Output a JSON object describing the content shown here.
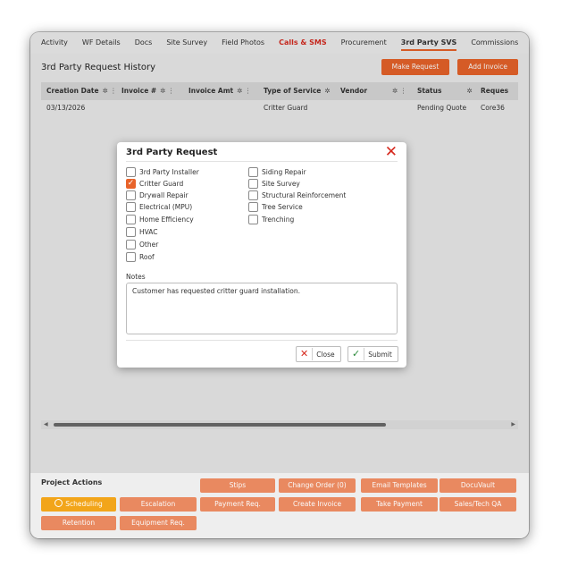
{
  "tabs": [
    "Activity",
    "WF Details",
    "Docs",
    "Site Survey",
    "Field Photos",
    "Calls & SMS",
    "Procurement",
    "3rd Party SVS",
    "Commissions"
  ],
  "tabs_highlight": "Calls & SMS",
  "tabs_active": "3rd Party SVS",
  "section_title": "3rd Party Request History",
  "buttons": {
    "make_request": "Make Request",
    "add_invoice": "Add Invoice"
  },
  "grid": {
    "columns": [
      "Creation Date",
      "Invoice #",
      "Invoice Amt",
      "Type of Service",
      "Vendor",
      "",
      "Status",
      "Reques"
    ],
    "rows": [
      {
        "creation_date": "03/13/2026",
        "invoice_no": "",
        "invoice_amt": "",
        "type_of_service": "Critter Guard",
        "vendor": "",
        "status": "Pending Quote",
        "request": "Core36"
      }
    ]
  },
  "dialog": {
    "title": "3rd Party Request",
    "close_icon": "close-x-icon",
    "options_left": [
      {
        "label": "3rd Party Installer",
        "checked": false
      },
      {
        "label": "Critter Guard",
        "checked": true
      },
      {
        "label": "Drywall Repair",
        "checked": false
      },
      {
        "label": "Electrical (MPU)",
        "checked": false
      },
      {
        "label": "Home Efficiency",
        "checked": false
      },
      {
        "label": "HVAC",
        "checked": false
      },
      {
        "label": "Other",
        "checked": false
      },
      {
        "label": "Roof",
        "checked": false
      }
    ],
    "options_right": [
      {
        "label": "Siding Repair",
        "checked": false
      },
      {
        "label": "Site Survey",
        "checked": false
      },
      {
        "label": "Structural Reinforcement",
        "checked": false
      },
      {
        "label": "Tree Service",
        "checked": false
      },
      {
        "label": "Trenching",
        "checked": false
      }
    ],
    "notes_label": "Notes",
    "notes_value": "Customer has requested critter guard installation.",
    "close_label": "Close",
    "submit_label": "Submit"
  },
  "project_actions": {
    "title": "Project Actions",
    "row1": [
      "Stips",
      "Change Order (0)",
      "Email Templates",
      "DocuVault"
    ],
    "row2": [
      "Scheduling",
      "Escalation",
      "Payment Req.",
      "Create Invoice",
      "Take Payment",
      "Sales/Tech QA"
    ],
    "row3": [
      "Retention",
      "Equipment Req."
    ]
  },
  "colors": {
    "accent": "#e8632a",
    "danger": "#d62a1f",
    "scheduling": "#f2a51a",
    "success": "#2e8b3d"
  }
}
